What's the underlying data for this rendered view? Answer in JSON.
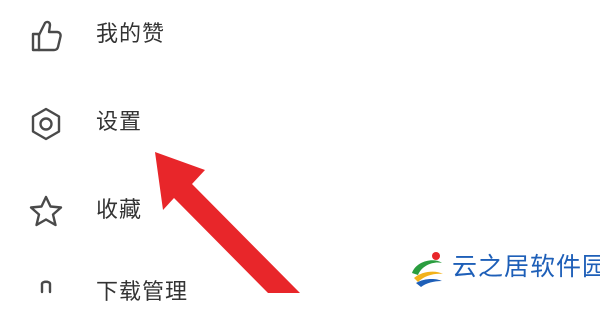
{
  "menu": {
    "items": [
      {
        "label": "我的赞",
        "icon": "thumbs-up-icon"
      },
      {
        "label": "设置",
        "icon": "gear-icon"
      },
      {
        "label": "收藏",
        "icon": "star-icon"
      },
      {
        "label": "下载管理",
        "icon": "download-icon"
      }
    ]
  },
  "annotation": {
    "arrow_color": "#e8262a",
    "points_to": "设置"
  },
  "watermark": {
    "text": "云之居软件园",
    "text_color": "#1e5fb8",
    "logo_icon": "swirl-logo-icon"
  }
}
